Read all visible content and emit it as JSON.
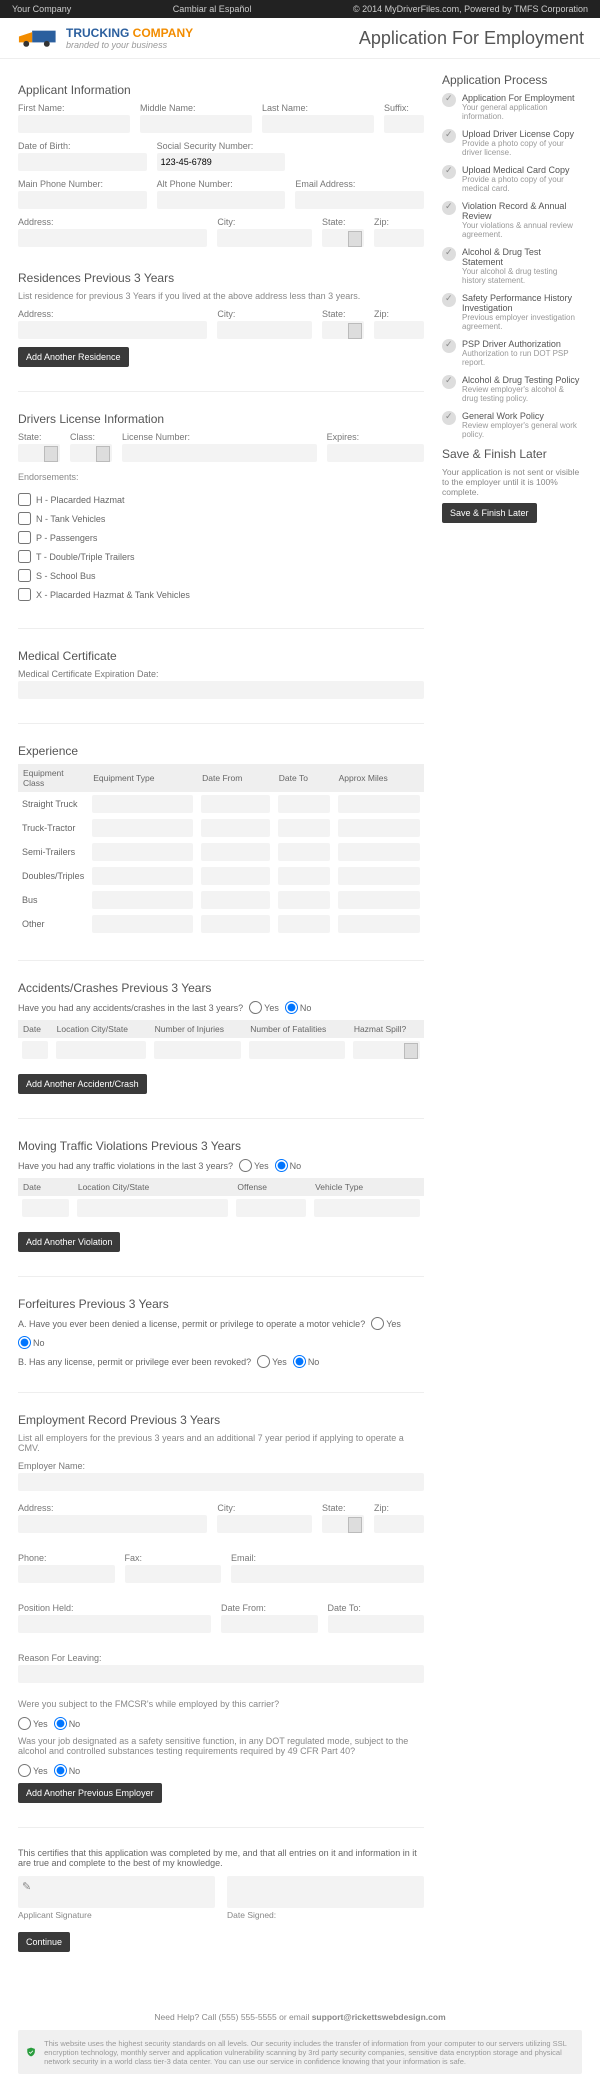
{
  "topbar": {
    "left": "Your Company",
    "center": "Cambiar al Español",
    "right": "© 2014 MyDriverFiles.com, Powered by TMFS Corporation"
  },
  "logo": {
    "line1": "TRUCKING",
    "line2": "COMPANY",
    "tagline": "branded to your business"
  },
  "page_title": "Application For Employment",
  "applicant": {
    "heading": "Applicant Information",
    "first": "First Name:",
    "middle": "Middle Name:",
    "last": "Last Name:",
    "suffix": "Suffix:",
    "dob": "Date of Birth:",
    "ssn": "Social Security Number:",
    "ssn_val": "123-45-6789",
    "main_phone": "Main Phone Number:",
    "alt_phone": "Alt Phone Number:",
    "email": "Email Address:",
    "address": "Address:",
    "city": "City:",
    "state": "State:",
    "zip": "Zip:"
  },
  "residences": {
    "heading": "Residences Previous 3 Years",
    "hint": "List residence for previous 3 Years if you lived at the above address less than 3 years.",
    "address": "Address:",
    "city": "City:",
    "state": "State:",
    "zip": "Zip:",
    "add": "Add Another Residence"
  },
  "license": {
    "heading": "Drivers License Information",
    "state": "State:",
    "class": "Class:",
    "number": "License Number:",
    "expires": "Expires:",
    "endorsements": "Endorsements:",
    "items": [
      "H - Placarded Hazmat",
      "N - Tank Vehicles",
      "P - Passengers",
      "T - Double/Triple Trailers",
      "S - School Bus",
      "X - Placarded Hazmat & Tank Vehicles"
    ]
  },
  "medical": {
    "heading": "Medical Certificate",
    "exp": "Medical Certificate Expiration Date:"
  },
  "experience": {
    "heading": "Experience",
    "cols": [
      "Equipment Class",
      "Equipment Type",
      "Date From",
      "Date To",
      "Approx Miles"
    ],
    "rows": [
      "Straight Truck",
      "Truck-Tractor",
      "Semi-Trailers",
      "Doubles/Triples",
      "Bus",
      "Other"
    ]
  },
  "accidents": {
    "heading": "Accidents/Crashes Previous 3 Years",
    "q": "Have you had any accidents/crashes in the last 3 years?",
    "yes": "Yes",
    "no": "No",
    "cols": [
      "Date",
      "Location City/State",
      "Number of Injuries",
      "Number of Fatalities",
      "Hazmat Spill?"
    ],
    "add": "Add Another Accident/Crash"
  },
  "violations": {
    "heading": "Moving Traffic Violations Previous 3 Years",
    "q": "Have you had any traffic violations in the last 3 years?",
    "yes": "Yes",
    "no": "No",
    "cols": [
      "Date",
      "Location City/State",
      "Offense",
      "Vehicle Type"
    ],
    "add": "Add Another Violation"
  },
  "forfeitures": {
    "heading": "Forfeitures Previous 3 Years",
    "qa": "A. Have you ever been denied a license, permit or privilege to operate a motor vehicle?",
    "qb": "B. Has any license, permit or privilege ever been revoked?",
    "yes": "Yes",
    "no": "No"
  },
  "employment": {
    "heading": "Employment Record Previous 3 Years",
    "hint": "List all employers for the previous 3 years and an additional 7 year period if applying to operate a CMV.",
    "employer": "Employer Name:",
    "address": "Address:",
    "city": "City:",
    "state": "State:",
    "zip": "Zip:",
    "phone": "Phone:",
    "fax": "Fax:",
    "email": "Email:",
    "position": "Position Held:",
    "from": "Date From:",
    "to": "Date To:",
    "reason": "Reason For Leaving:",
    "q1": "Were you subject to the FMCSR's while employed by this carrier?",
    "q2": "Was your job designated as a safety sensitive function, in any DOT regulated mode, subject to the alcohol and controlled substances testing requirements required by 49 CFR Part 40?",
    "yes": "Yes",
    "no": "No",
    "add": "Add Another Previous Employer"
  },
  "cert": {
    "text": "This certifies that this application was completed by me, and that all entries on it and information in it are true and complete to the best of my knowledge.",
    "sig": "Applicant Signature",
    "date": "Date Signed:",
    "continue": "Continue"
  },
  "footer": {
    "help": "Need Help? Call (555) 555-5555 or email ",
    "email": "support@rickettswebdesign.com",
    "security": "This website uses the highest security standards on all levels. Our security includes the transfer of information from your computer to our servers utilizing SSL encryption technology, monthly server and application vulnerability scanning by 3rd party security companies, sensitive data encryption storage and physical network security in a world class tier-3 data center. You can use our service in confidence knowing that your information is safe."
  },
  "sidebar": {
    "heading": "Application Process",
    "steps": [
      {
        "t": "Application For Employment",
        "d": "Your general application information."
      },
      {
        "t": "Upload Driver License Copy",
        "d": "Provide a photo copy of your driver license."
      },
      {
        "t": "Upload Medical Card Copy",
        "d": "Provide a photo copy of your medical card."
      },
      {
        "t": "Violation Record & Annual Review",
        "d": "Your violations & annual review agreement."
      },
      {
        "t": "Alcohol & Drug Test Statement",
        "d": "Your alcohol & drug testing history statement."
      },
      {
        "t": "Safety Performance History Investigation",
        "d": "Previous employer investigation agreement."
      },
      {
        "t": "PSP Driver Authorization",
        "d": "Authorization to run DOT PSP report."
      },
      {
        "t": "Alcohol & Drug Testing Policy",
        "d": "Review employer's alcohol & drug testing policy."
      },
      {
        "t": "General Work Policy",
        "d": "Review employer's general work policy."
      }
    ],
    "save": {
      "heading": "Save & Finish Later",
      "desc": "Your application is not sent or visible to the employer until it is 100% complete.",
      "btn": "Save & Finish Later"
    }
  }
}
